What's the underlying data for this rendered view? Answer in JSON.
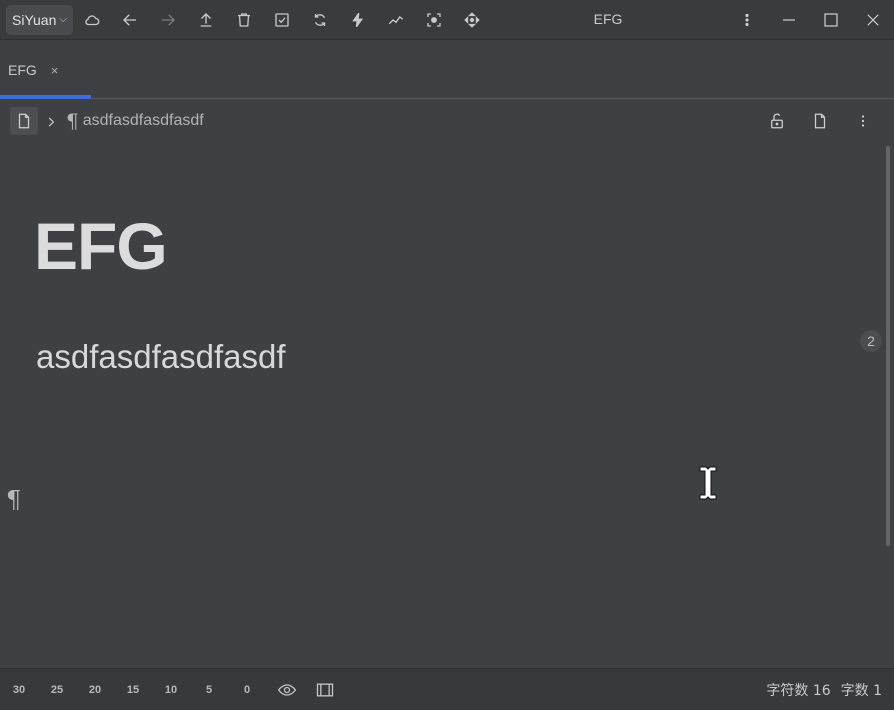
{
  "toolbar": {
    "brand_label": "SiYuan",
    "icons": [
      "cloud-icon",
      "back-arrow-icon",
      "forward-arrow-icon",
      "upload-icon",
      "trash-icon",
      "checkbox-icon",
      "sync-icon",
      "lightning-icon",
      "graph-icon",
      "focus-icon",
      "move-icon"
    ]
  },
  "window": {
    "title": "EFG"
  },
  "tabs": [
    {
      "label": "EFG",
      "close": "×"
    }
  ],
  "breadcrumb": {
    "para_symbol": "¶",
    "text": "asdfasdfasdfasdf"
  },
  "document": {
    "title": "EFG",
    "paragraph": "asdfasdfasdfasdf",
    "ref_count": "2",
    "empty_block_symbol": "¶"
  },
  "statusbar": {
    "zoom_ticks": [
      "30",
      "25",
      "20",
      "15",
      "10",
      "5",
      "0"
    ],
    "char_count_label": "字符数 16",
    "word_count_label": "字数 1"
  },
  "colors": {
    "accent": "#3b6fd8",
    "background": "#3f4043",
    "toolbar": "#3a3b3d"
  }
}
